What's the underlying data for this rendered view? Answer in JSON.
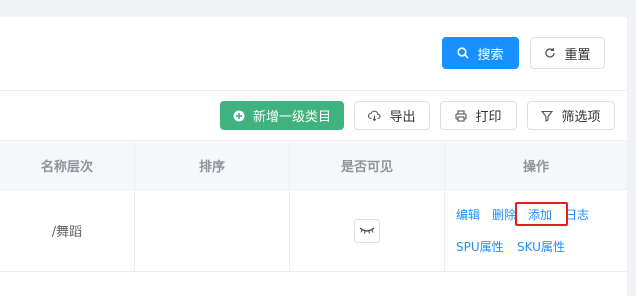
{
  "search_panel": {
    "search_label": "搜索",
    "reset_label": "重置"
  },
  "toolbar": {
    "add_label": "新增一级类目",
    "export_label": "导出",
    "print_label": "打印",
    "filter_label": "筛选项"
  },
  "table": {
    "headers": [
      "名称层次",
      "排序",
      "是否可见",
      "操作"
    ],
    "rows": [
      {
        "name": "/舞蹈",
        "sort": "",
        "actions": [
          "编辑",
          "删除",
          "添加",
          "日志",
          "SPU属性",
          "SKU属性"
        ]
      }
    ]
  },
  "colors": {
    "primary": "#1890ff",
    "success": "#3fb27f",
    "highlight": "#e02020"
  }
}
